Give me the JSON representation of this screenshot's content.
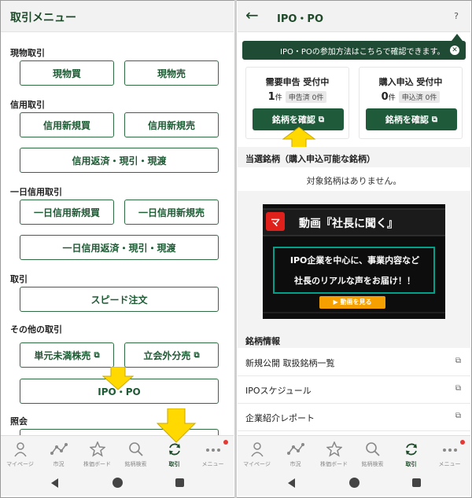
{
  "left": {
    "header": {
      "title": "取引メニュー"
    },
    "sections": {
      "spot": "現物取引",
      "margin": "信用取引",
      "day_margin": "一日信用取引",
      "trade": "取引",
      "other": "その他の取引",
      "inquiry": "照会"
    },
    "buttons": {
      "spot_buy": "現物買",
      "spot_sell": "現物売",
      "margin_new_buy": "信用新規買",
      "margin_new_sell": "信用新規売",
      "margin_close": "信用返済・現引・現渡",
      "day_new_buy": "一日信用新規買",
      "day_new_sell": "一日信用新規売",
      "day_close": "一日信用返済・現引・現渡",
      "speed_order": "スピード注文",
      "odd_lot_sell": "単元未満株売",
      "off_floor_sell": "立会外分売",
      "ipo_po": "IPO・PO"
    }
  },
  "nav": [
    {
      "label": "マイページ"
    },
    {
      "label": "市況"
    },
    {
      "label": "株価ボード"
    },
    {
      "label": "銘柄検索"
    },
    {
      "label": "取引"
    },
    {
      "label": "メニュー"
    }
  ],
  "right": {
    "header": {
      "title": "IPO・PO",
      "help": "?"
    },
    "tooltip": {
      "text": "IPO・POの参加方法はこちらで確認できます。"
    },
    "cards": [
      {
        "title": "需要申告 受付中",
        "count": "1",
        "unit": "件",
        "chip": "申告済 0件",
        "button": "銘柄を確認"
      },
      {
        "title": "購入申込 受付中",
        "count": "0",
        "unit": "件",
        "chip": "申込済 0件",
        "button": "銘柄を確認"
      }
    ],
    "winning": {
      "heading": "当選銘柄（購入申込可能な銘柄）",
      "empty": "対象銘柄はありません。"
    },
    "banner": {
      "logo": "マ",
      "title": "動画『社長に聞く』",
      "line1": "IPO企業を中心に、事業内容など",
      "line2": "社長のリアルな声をお届け！！",
      "cta": "▶ 動画を見る"
    },
    "info": {
      "heading": "銘柄情報",
      "items": [
        "新規公開 取扱銘柄一覧",
        "IPOスケジュール",
        "企業紹介レポート"
      ]
    }
  },
  "colors": {
    "brand_green": "#1f5a3a",
    "highlight_yellow": "#ffd900",
    "badge_red": "#e53935"
  }
}
